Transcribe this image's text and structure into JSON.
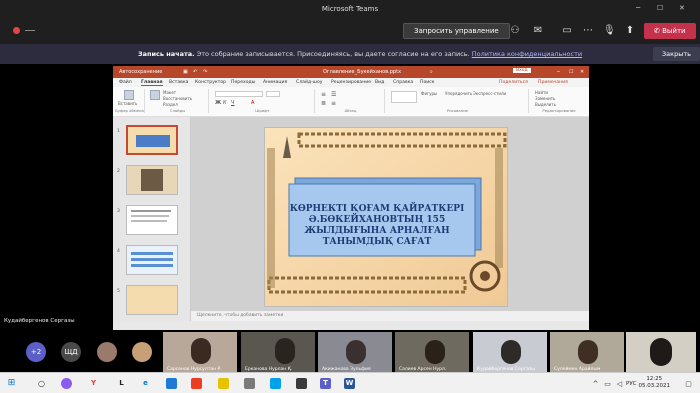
{
  "window": {
    "title": "Microsoft Teams"
  },
  "call": {
    "request_control_label": "Запросить управление",
    "leave_label": "Выйти"
  },
  "banner": {
    "bold": "Запись начата.",
    "text": " Это собрание записывается. Присоединяясь, вы даете согласие на его запись.",
    "link": "Политика конфиденциальности",
    "close_label": "Закрыть"
  },
  "ppt": {
    "title": "Оглавление_Букейханов.pptx",
    "autosave_label": "Автосохранение",
    "tabs": [
      "Файл",
      "Главная",
      "Вставка",
      "Конструктор",
      "Переходы",
      "Анимация",
      "Слайд-шоу",
      "Рецензирование",
      "Вид",
      "Справка",
      "Поиск"
    ],
    "share_label": "Поделиться",
    "notes_label": "Примечания",
    "ribbon_groups": [
      "Буфер обмена",
      "Слайды",
      "Шрифт",
      "Абзац",
      "Рисование",
      "Редактирование"
    ],
    "ribbon_items": [
      "Вставить",
      "Создать слайд",
      "Макет",
      "Восстановить",
      "Раздел",
      "Фигуры",
      "Упорядочить",
      "Экспресс-стили",
      "Найти",
      "Заменить",
      "Выделить"
    ],
    "thumb_numbers": [
      "1",
      "2",
      "3",
      "4",
      "5"
    ],
    "notes_placeholder": "Щелкните, чтобы добавить заметки",
    "slide_title": "КӨРНЕКТІ ҚОҒАМ ҚАЙРАТКЕРІ Ә.БӨКЕЙХАНОВТЫҢ 155 ЖЫЛДЫҒЫНА АРНАЛҒАН ТАНЫМДЫҚ САҒАТ"
  },
  "presenter": {
    "name": "Кудайбергенов Сергазы"
  },
  "participants": {
    "overflow": "+2",
    "initials": "ЩД",
    "tiles": [
      "Сарсенов Нурсултан Р.",
      "Ерканова Нурлан Қ.",
      "Акижанова Зульфия",
      "Салиев Арсен Нурл.",
      "Кудайбергенов Сергазы",
      "Сулеймен Арайлым",
      ""
    ]
  },
  "taskbar": {
    "lang": "РУС",
    "time": "12:25",
    "date": "05.03.2021"
  },
  "colors": {
    "teams_bg": "#1f1f1f",
    "ppt_accent": "#b7472a",
    "hangup": "#c4314b",
    "slide_blue": "#1f3b73"
  }
}
